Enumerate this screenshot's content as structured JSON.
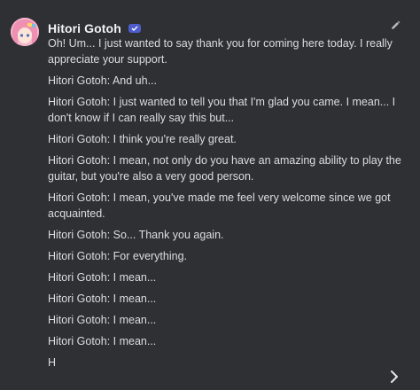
{
  "header": {
    "name": "Hitori Gotoh",
    "badge_icon": "verified-badge-icon"
  },
  "icons": {
    "avatar": "pink-hair-character-avatar",
    "edit": "pencil-icon",
    "next": "chevron-right-icon"
  },
  "colors": {
    "background": "#2f3033",
    "text": "#dbdee1",
    "name": "#f2f3f5",
    "badge": "#4e5dcc"
  },
  "message": {
    "paragraphs": [
      "Oh! Um... I just wanted to say thank you for coming here today. I really appreciate your support.",
      "Hitori Gotoh: And uh...",
      "Hitori Gotoh: I just wanted to tell you that I'm glad you came. I mean... I don't know if I can really say this but...",
      "Hitori Gotoh: I think you're really great.",
      "Hitori Gotoh: I mean, not only do you have an amazing ability to play the guitar, but you're also a very good person.",
      "Hitori Gotoh: I mean, you've made me feel very welcome since we got acquainted.",
      "Hitori Gotoh: So... Thank you again.",
      "Hitori Gotoh: For everything.",
      "Hitori Gotoh: I mean...",
      "Hitori Gotoh: I mean...",
      "Hitori Gotoh: I mean...",
      "Hitori Gotoh: I mean...",
      "H"
    ]
  }
}
